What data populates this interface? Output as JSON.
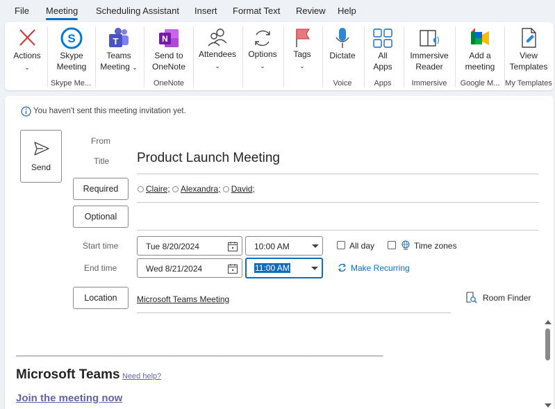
{
  "menu": {
    "items": [
      "File",
      "Meeting",
      "Scheduling Assistant",
      "Insert",
      "Format Text",
      "Review",
      "Help"
    ],
    "active": "Meeting"
  },
  "ribbon": {
    "actions": "Actions",
    "skype_meeting_l1": "Skype",
    "skype_meeting_l2": "Meeting",
    "teams_meeting_l1": "Teams",
    "teams_meeting_l2": "Meeting",
    "send_onenote_l1": "Send to",
    "send_onenote_l2": "OneNote",
    "attendees": "Attendees",
    "options": "Options",
    "tags": "Tags",
    "dictate": "Dictate",
    "all_apps_l1": "All",
    "all_apps_l2": "Apps",
    "immersive_l1": "Immersive",
    "immersive_l2": "Reader",
    "add_meeting_l1": "Add a",
    "add_meeting_l2": "meeting",
    "view_templates_l1": "View",
    "view_templates_l2": "Templates",
    "groups": {
      "skype": "Skype Me...",
      "onenote": "OneNote",
      "voice": "Voice",
      "apps": "Apps",
      "immersive": "Immersive",
      "google": "Google M...",
      "templates": "My Templates"
    },
    "colors": {
      "teams": "#5b5fc7",
      "onenote": "#7719aa",
      "skype": "#0078d4",
      "accent": "#0f6cbd"
    }
  },
  "form": {
    "info": "You haven't sent this meeting invitation yet.",
    "send": "Send",
    "from_label": "From",
    "title_label": "Title",
    "title_value": "Product Launch Meeting",
    "required_button": "Required",
    "optional_button": "Optional",
    "attendees": [
      "Claire;",
      "Alexandra;",
      "David;"
    ],
    "start_label": "Start time",
    "end_label": "End time",
    "start_date": "Tue 8/20/2024",
    "start_time": "10:00 AM",
    "end_date": "Wed 8/21/2024",
    "end_time": "11:00 AM",
    "all_day": "All day",
    "time_zones": "Time zones",
    "make_recurring": "Make Recurring",
    "location_button": "Location",
    "location_value": "Microsoft Teams Meeting",
    "room_finder": "Room Finder"
  },
  "body": {
    "divider": "________________________________________________________________________________",
    "teams_title": "Microsoft Teams",
    "need_help": "Need help?",
    "join_link": "Join the meeting now"
  }
}
